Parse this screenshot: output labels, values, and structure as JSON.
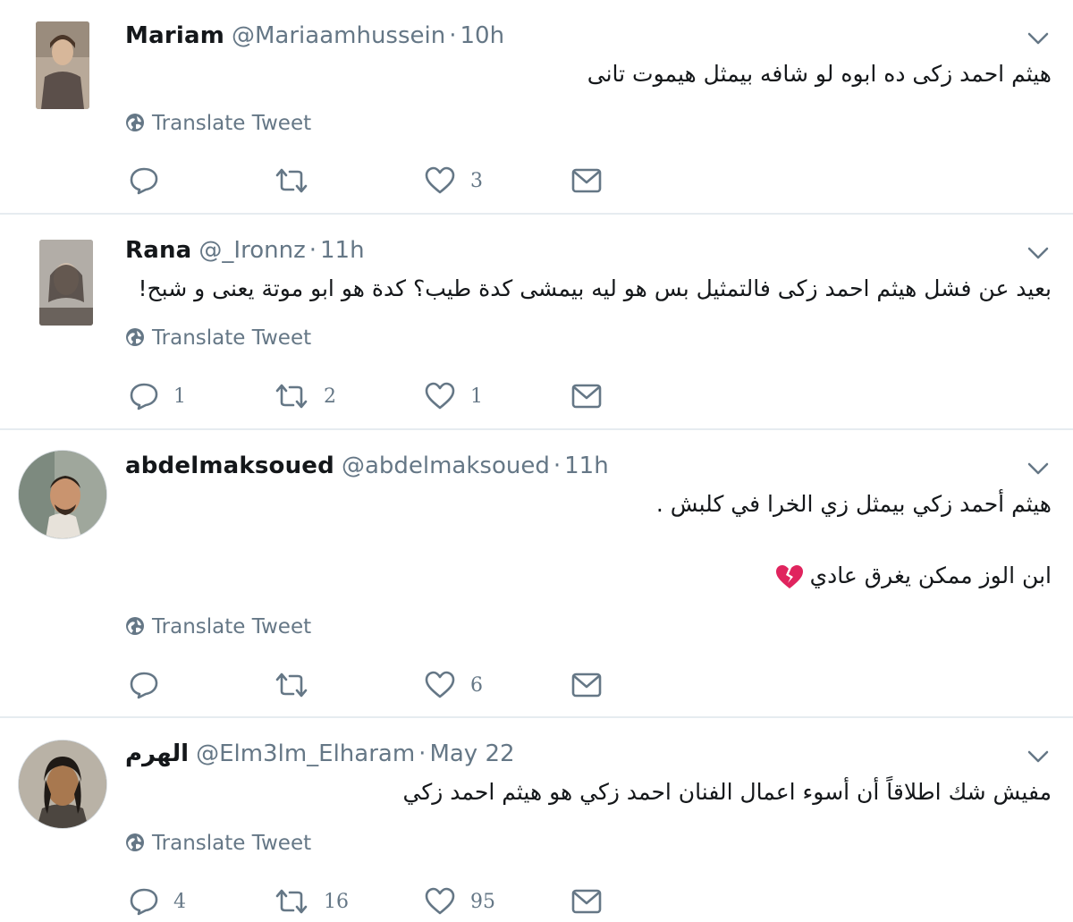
{
  "tweets": [
    {
      "name": "Mariam",
      "handle": "@Mariaamhussein",
      "separator": "·",
      "time": "10h",
      "lines": [
        "هيثم احمد زكى ده ابوه لو شافه بيمثل هيموت تانى"
      ],
      "translate_label": "Translate Tweet",
      "counts": {
        "reply": "",
        "retweet": "",
        "like": "3"
      }
    },
    {
      "name": "Rana",
      "handle": "@_Ironnz",
      "separator": "·",
      "time": "11h",
      "lines": [
        "بعيد عن فشل هيثم احمد زكى فالتمثيل بس هو ليه بيمشى كدة طيب؟ كدة هو ابو موتة يعنى و شبح!"
      ],
      "translate_label": "Translate Tweet",
      "counts": {
        "reply": "1",
        "retweet": "2",
        "like": "1"
      }
    },
    {
      "name": "abdelmaksoued",
      "handle": "@abdelmaksoued",
      "separator": "·",
      "time": "11h",
      "lines": [
        "هيثم أحمد زكي بيمثل زي الخرا في كلبش .",
        "ابن الوز ممكن يغرق عادي"
      ],
      "emoji": "broken-heart-emoji",
      "translate_label": "Translate Tweet",
      "counts": {
        "reply": "",
        "retweet": "",
        "like": "6"
      }
    },
    {
      "name": "الهرم",
      "handle": "@Elm3lm_Elharam",
      "separator": "·",
      "time": "May 22",
      "lines": [
        "مفيش شك اطلاقاً أن أسوء اعمال الفنان احمد زكي هو هيثم احمد زكي"
      ],
      "translate_label": "Translate Tweet",
      "counts": {
        "reply": "4",
        "retweet": "16",
        "like": "95"
      }
    }
  ],
  "icons": {
    "reply": "reply-icon",
    "retweet": "retweet-icon",
    "like": "heart-icon",
    "dm": "envelope-icon",
    "caret": "chevron-down-icon",
    "translate": "globe-icon"
  },
  "colors": {
    "name": "#14171a",
    "meta": "#657786",
    "icon": "#657786",
    "divider": "#e6ecf0",
    "broken_heart": "#e0245e"
  }
}
